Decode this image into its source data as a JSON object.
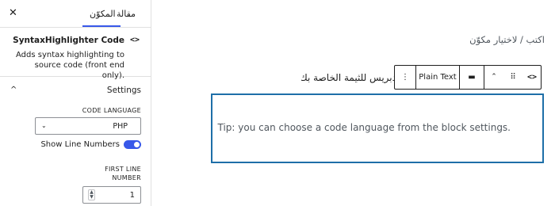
{
  "sidebar": {
    "tabs": [
      {
        "label": "مقالة"
      },
      {
        "label": "المكوّن"
      }
    ],
    "close_icon": "close-icon",
    "block": {
      "icon": "code-icon",
      "icon_glyph": "<>",
      "title": "SyntaxHighlighter Code",
      "description": "Adds syntax highlighting to\nsource code (front end only)."
    },
    "settings": {
      "label": "Settings",
      "code_language_label": "CODE LANGUAGE",
      "code_language_value": "PHP",
      "show_line_numbers_label": "Show Line Numbers",
      "show_line_numbers_on": true,
      "first_line_number_label": "FIRST LINE\nNUMBER",
      "first_line_number_value": "1"
    }
  },
  "editor": {
    "breadcrumb": "اكتب / لاختيار مكوّن",
    "paragraph_text": "دبريس للثيمة الخاصة بك",
    "toolbar": {
      "more_glyph": "⋮",
      "plain_text_label": "Plain Text",
      "align_glyph": "▬",
      "move_glyph": "⌃",
      "drag_glyph": "⠿",
      "code_glyph": "<>"
    },
    "tip": "Tip: you can choose a code language from the block settings."
  },
  "colors": {
    "accent": "#3858e9",
    "block_border": "#1e6fa8"
  }
}
